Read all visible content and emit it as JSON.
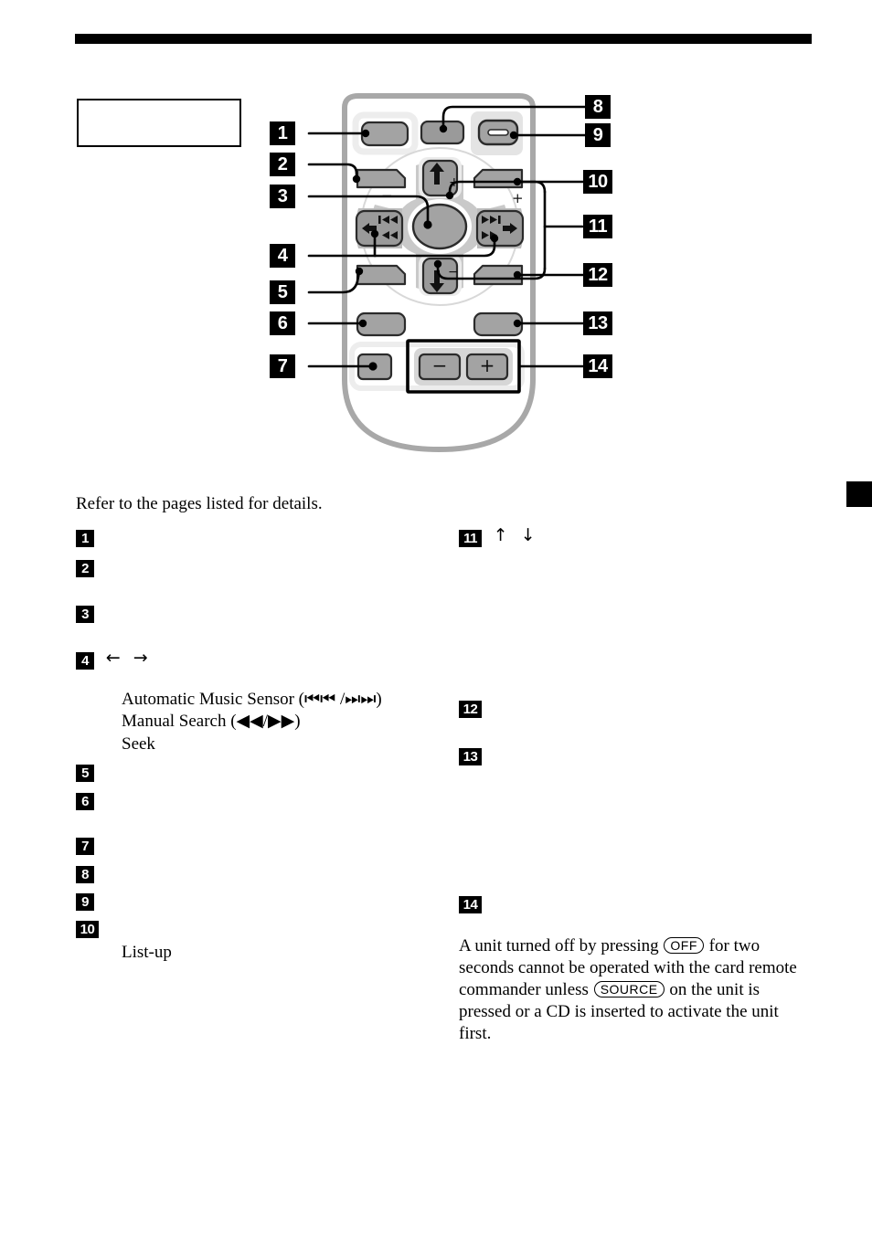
{
  "page": {
    "tab_marker": "black-page-tab",
    "top_rule": "black-bar"
  },
  "caption_box": {
    "text": ""
  },
  "diagram": {
    "title": "card-remote-commander",
    "callouts": [
      {
        "n": "1",
        "side": "left",
        "target": "source-button"
      },
      {
        "n": "2",
        "side": "left",
        "target": "mode-button"
      },
      {
        "n": "3",
        "side": "left",
        "target": "center-enter-dial"
      },
      {
        "n": "4",
        "side": "left",
        "target": "seek-left-right-buttons"
      },
      {
        "n": "5",
        "side": "left",
        "target": "menu-button-left"
      },
      {
        "n": "6",
        "side": "left",
        "target": "dspl-button"
      },
      {
        "n": "7",
        "side": "left",
        "target": "att-button"
      },
      {
        "n": "8",
        "side": "right",
        "target": "small-top-button"
      },
      {
        "n": "9",
        "side": "right",
        "target": "off-button"
      },
      {
        "n": "10",
        "side": "right",
        "target": "upper-right-button"
      },
      {
        "n": "11",
        "side": "right",
        "target": "up-down-buttons"
      },
      {
        "n": "12",
        "side": "right",
        "target": "lower-right-button"
      },
      {
        "n": "13",
        "side": "right",
        "target": "sound-button"
      },
      {
        "n": "14",
        "side": "right",
        "target": "volume-minus-plus-buttons"
      }
    ],
    "labels": {
      "up_plus": "+",
      "down_minus": "−",
      "left_minus": "−",
      "right_plus": "+",
      "vol_minus": "−",
      "vol_plus": "+"
    }
  },
  "intro": "Refer to the pages listed for details.",
  "list_left": [
    {
      "n": "1",
      "text": "",
      "details": []
    },
    {
      "n": "2",
      "text": "",
      "details": []
    },
    {
      "n": "3",
      "text": "",
      "details": []
    },
    {
      "n": "4",
      "text": "",
      "arrows": "←  →",
      "details": [
        "Automatic Music Sensor (⏮⏮ /⏭⏭)",
        "Manual Search (◀◀/▶▶)",
        "Seek"
      ]
    },
    {
      "n": "5",
      "text": "",
      "details": []
    },
    {
      "n": "6",
      "text": "",
      "details": []
    },
    {
      "n": "7",
      "text": "",
      "details": []
    },
    {
      "n": "8",
      "text": "",
      "details": []
    },
    {
      "n": "9",
      "text": "",
      "details": []
    },
    {
      "n": "10",
      "text": "",
      "details": [
        "List-up"
      ]
    }
  ],
  "list_right": [
    {
      "n": "11",
      "text": "",
      "arrows": "↑  ↓",
      "details": []
    },
    {
      "n": "12",
      "text": "",
      "details": []
    },
    {
      "n": "13",
      "text": "",
      "details": []
    },
    {
      "n": "14",
      "text": "",
      "details": []
    }
  ],
  "note": {
    "part1": "A unit turned off by pressing",
    "key1": "OFF",
    "part2": "for two seconds cannot be operated with the card remote commander unless",
    "key2": "SOURCE",
    "part3": "on the unit is pressed or a CD is inserted to activate the unit first."
  },
  "colors": {
    "ink": "#000000",
    "paper": "#ffffff",
    "body_outline": "#a8a8a8",
    "button_face": "#a3a3a3",
    "button_face_dark": "#9a9a9a",
    "panel_light": "#ebebeb",
    "dpad_ring": "#c9c9c9"
  }
}
